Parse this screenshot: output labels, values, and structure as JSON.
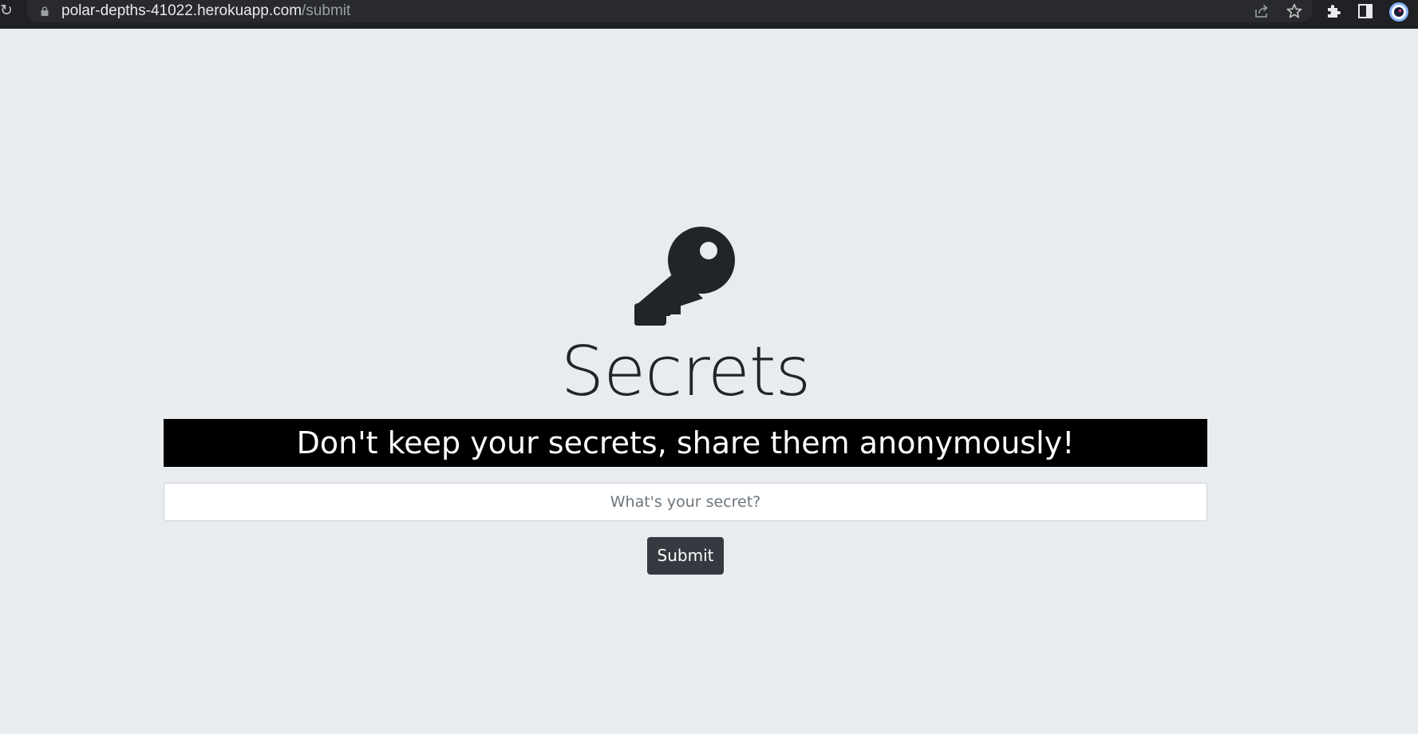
{
  "browser": {
    "url_host": "polar-depths-41022.herokuapp.com",
    "url_path": "/submit",
    "icons": [
      "reload-icon",
      "lock-icon",
      "share-icon",
      "star-icon",
      "extensions-icon",
      "side-panel-icon",
      "profile-avatar-icon"
    ]
  },
  "page": {
    "title": "Secrets",
    "tagline": "Don't keep your secrets, share them anonymously!",
    "secret_placeholder": "What's your secret?",
    "secret_value": "",
    "submit_label": "Submit",
    "icon": "key-icon"
  },
  "colors": {
    "page_background": "#e9ecef",
    "banner_background": "#000000",
    "button_background": "#343a40",
    "browser_bar": "#202124"
  }
}
